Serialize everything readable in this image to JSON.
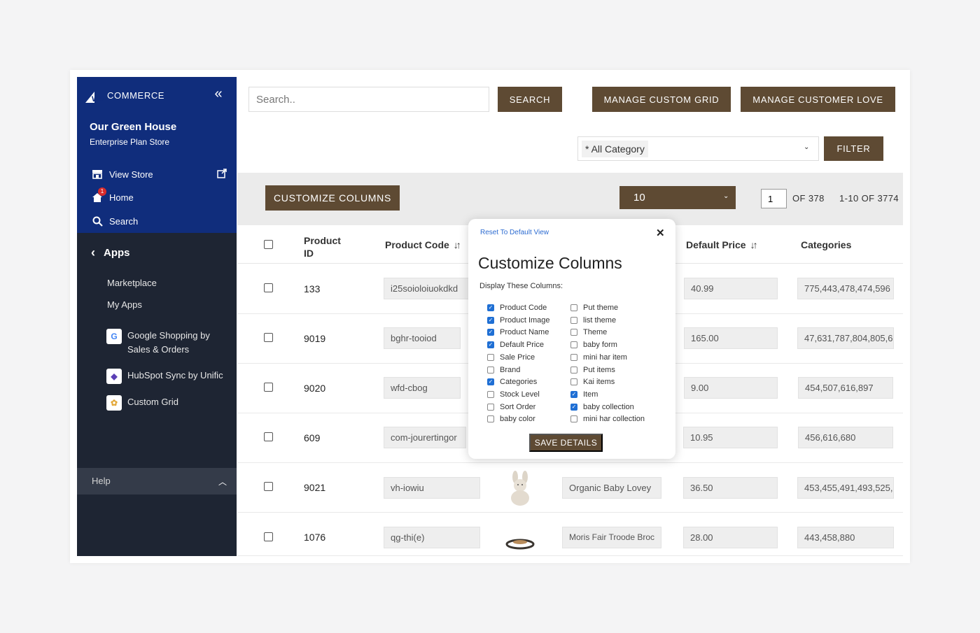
{
  "sidebar": {
    "brand": "COMMERCE",
    "brand_prefix": "WB",
    "store_name": "Our Green House",
    "store_plan": "Enterprise Plan Store",
    "links": [
      {
        "label": "View Store",
        "icon": "storefront-icon"
      },
      {
        "label": "Home",
        "icon": "home-icon",
        "badge": "1"
      },
      {
        "label": "Search",
        "icon": "search-icon"
      }
    ],
    "apps_label": "Apps",
    "sub_links": [
      "Marketplace",
      "My Apps"
    ],
    "apps": [
      {
        "label_line1": "Google Shopping by",
        "label_line2": "Sales & Orders",
        "icon": "google-icon"
      },
      {
        "label_line1": "HubSpot Sync by Unific",
        "label_line2": "",
        "icon": "hubspot-icon"
      },
      {
        "label_line1": "Custom Grid",
        "label_line2": "",
        "icon": "custom-grid-icon"
      }
    ],
    "help_label": "Help"
  },
  "top": {
    "search_placeholder": "Search..",
    "search_button": "SEARCH",
    "manage_grid_button": "MANAGE CUSTOM GRID",
    "manage_love_button": "MANAGE CUSTOMER LOVE",
    "category_value": "* All Category",
    "filter_button": "FILTER"
  },
  "toolbar": {
    "customize_button": "CUSTOMIZE COLUMNS",
    "per_page": "10",
    "page_value": "1",
    "of_pages": "OF  378",
    "range": "1-10 OF 3774"
  },
  "table": {
    "headers": {
      "product_id_line1": "Product",
      "product_id_line2": "ID",
      "product_code": "Product Code",
      "default_price": "Default Price",
      "categories": "Categories"
    },
    "rows": [
      {
        "id": "133",
        "code": "i25soioloiuokdkd",
        "name": "",
        "price": "40.99",
        "categories": "775,443,478,474,596"
      },
      {
        "id": "9019",
        "code": "bghr-tooiod",
        "name": "",
        "price": "165.00",
        "categories": "47,631,787,804,805,6"
      },
      {
        "id": "9020",
        "code": "wfd-cbog",
        "name": "",
        "price": "9.00",
        "categories": "454,507,616,897"
      },
      {
        "id": "609",
        "code": "com-jourertingor",
        "name": "",
        "price": "10.95",
        "categories": "456,616,680"
      },
      {
        "id": "9021",
        "code": "vh-iowiu",
        "name": "Organic Baby Lovey",
        "price": "36.50",
        "categories": "453,455,491,493,525,6"
      },
      {
        "id": "1076",
        "code": "qg-thi(e)",
        "name": "Moris Fair Troode Broc",
        "price": "28.00",
        "categories": "443,458,880"
      }
    ]
  },
  "modal": {
    "reset_link": "Reset To Default View",
    "title": "Customize Columns",
    "subtitle": "Display These Columns:",
    "left_options": [
      {
        "label": "Product Code",
        "checked": true
      },
      {
        "label": "Product Image",
        "checked": true
      },
      {
        "label": "Product Name",
        "checked": true
      },
      {
        "label": "Default Price",
        "checked": true
      },
      {
        "label": "Sale Price",
        "checked": false
      },
      {
        "label": "Brand",
        "checked": false
      },
      {
        "label": "Categories",
        "checked": true
      },
      {
        "label": "Stock Level",
        "checked": false
      },
      {
        "label": "Sort Order",
        "checked": false
      },
      {
        "label": "baby color",
        "checked": false
      }
    ],
    "right_options": [
      {
        "label": "Put theme",
        "checked": false
      },
      {
        "label": "list theme",
        "checked": false
      },
      {
        "label": "Theme",
        "checked": false
      },
      {
        "label": "baby form",
        "checked": false
      },
      {
        "label": "mini har item",
        "checked": false
      },
      {
        "label": "Put items",
        "checked": false
      },
      {
        "label": "Kai items",
        "checked": false
      },
      {
        "label": "Item",
        "checked": true
      },
      {
        "label": "baby collection",
        "checked": true
      },
      {
        "label": "mini har collection",
        "checked": false
      }
    ],
    "save_button": "SAVE DETAILS"
  },
  "colors": {
    "sidebar_top": "#102d7c",
    "sidebar_bottom": "#1e2533",
    "brown_button": "#5e4a33",
    "checkbox_blue": "#1f6fd4",
    "link_blue": "#2c6bd1"
  }
}
